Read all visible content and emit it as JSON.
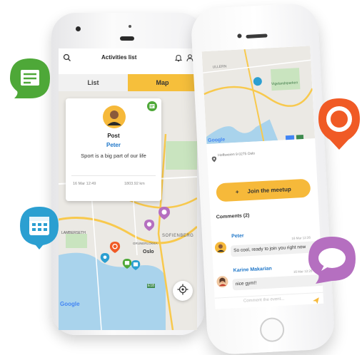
{
  "colors": {
    "accent_yellow": "#f6bf3b",
    "green_badge": "#4ea838",
    "blue_badge": "#2b9fd1",
    "orange_badge": "#f05a25",
    "purple_badge": "#b56fc0",
    "link_blue": "#1f77c9"
  },
  "left_phone": {
    "header": {
      "title": "Activities list",
      "search_icon": "search-icon",
      "bell_icon": "bell-icon",
      "profile_icon": "user-icon"
    },
    "tabs": {
      "list": "List",
      "map": "Map"
    },
    "card": {
      "type": "Post",
      "author": "Peter",
      "text": "Sport is a big part of our life",
      "date": "16 Mar 12:49",
      "distance": "1803.92 km"
    },
    "map_labels": {
      "city": "Oslo",
      "district_1": "LAMBERSETH",
      "district_2": "SOFIENBERG",
      "district_3": "GRUNERLOKKA",
      "highway": "E18",
      "google": "Google"
    }
  },
  "right_phone": {
    "map_labels": {
      "place": "Vigelandsparken",
      "area": "ULLERN",
      "google": "Google"
    },
    "address": "Hoffsveien 9 0275 Oslo",
    "join_button": {
      "plus": "+",
      "label": "Join the meetup"
    },
    "comments_header": "Comments (2)",
    "comments": [
      {
        "author": "Peter",
        "time": "16 Mar 12:26",
        "text": "So cool, ready to join you right now"
      },
      {
        "author": "Karine Makarian",
        "time": "16 Mar 12:26",
        "text": "nice gym!!"
      }
    ],
    "comment_placeholder": "Comment the event..."
  },
  "badges": {
    "green": "document-icon",
    "blue": "calendar-icon",
    "orange": "lifebuoy-icon",
    "purple": "chat-icon"
  }
}
